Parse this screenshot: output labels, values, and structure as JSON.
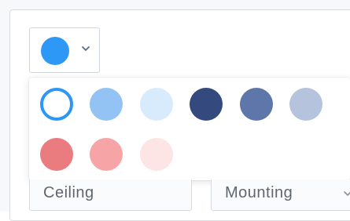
{
  "color_picker": {
    "selected_color": "#2d98f5",
    "trigger_icon": "chevron-down-icon",
    "swatches": [
      {
        "color": "#ffffff",
        "selected": true
      },
      {
        "color": "#93c3f4"
      },
      {
        "color": "#d8ebfd"
      },
      {
        "color": "#344a7e"
      },
      {
        "color": "#5e76a9"
      },
      {
        "color": "#b6c3dc"
      },
      {
        "color": "#ea7c80"
      },
      {
        "color": "#f6a4a6"
      },
      {
        "color": "#fde4e5"
      }
    ]
  },
  "form": {
    "ceiling_label": "Ceiling",
    "mounting_label": "Mounting",
    "mounting_icon": "chevron-down-icon"
  }
}
